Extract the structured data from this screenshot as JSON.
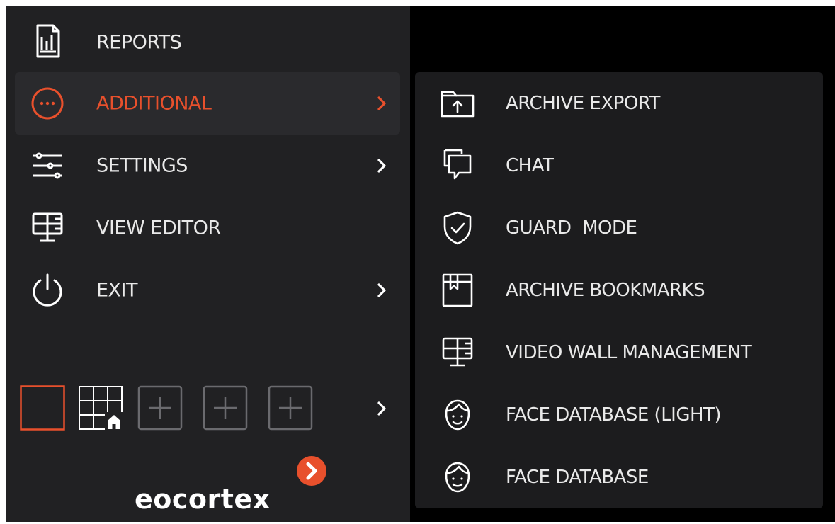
{
  "menu": {
    "items": [
      {
        "label": "REPORTS",
        "icon": "reports-icon",
        "has_submenu": false,
        "active": false
      },
      {
        "label": "ADDITIONAL",
        "icon": "more-icon",
        "has_submenu": true,
        "active": true
      },
      {
        "label": "SETTINGS",
        "icon": "sliders-icon",
        "has_submenu": true,
        "active": false
      },
      {
        "label": "VIEW EDITOR",
        "icon": "monitor-grid-icon",
        "has_submenu": false,
        "active": false
      },
      {
        "label": "EXIT",
        "icon": "power-icon",
        "has_submenu": true,
        "active": false
      }
    ]
  },
  "layouts": {
    "tiles": [
      "layout-single",
      "layout-grid-home",
      "layout-add",
      "layout-add",
      "layout-add"
    ],
    "has_submenu": true
  },
  "logo": {
    "text": "eocortex"
  },
  "submenu": {
    "items": [
      {
        "label": "ARCHIVE EXPORT",
        "icon": "folder-upload-icon"
      },
      {
        "label": "CHAT",
        "icon": "chat-icon"
      },
      {
        "label": "GUARD  MODE",
        "icon": "shield-check-icon"
      },
      {
        "label": "ARCHIVE BOOKMARKS",
        "icon": "bookmark-icon"
      },
      {
        "label": "VIDEO WALL MANAGEMENT",
        "icon": "monitor-grid-icon"
      },
      {
        "label": "FACE DATABASE (LIGHT)",
        "icon": "face-icon"
      },
      {
        "label": "FACE DATABASE",
        "icon": "face-icon"
      }
    ]
  },
  "colors": {
    "panel_bg": "#212123",
    "submenu_bg": "#1c1c1e",
    "accent": "#e8502c",
    "text": "#e9e9e9"
  }
}
